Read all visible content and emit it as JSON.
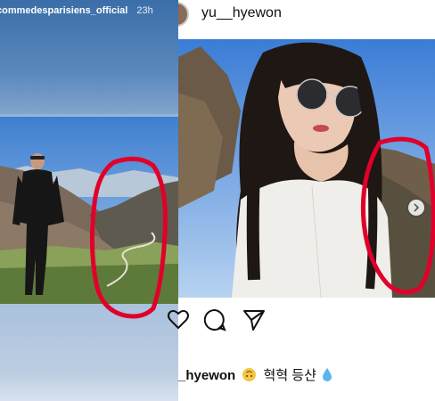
{
  "story": {
    "username": "commedesparisiens_official",
    "time": "23h"
  },
  "post": {
    "username": "yu__hyewon",
    "caption_username": "_hyewon",
    "caption_text": "혁혁 등샨"
  },
  "icons": {
    "like": "heart-icon",
    "comment": "comment-icon",
    "share": "share-icon",
    "next": "chevron-right-icon"
  },
  "colors": {
    "annotation": "#e0002a",
    "text": "#111111"
  }
}
